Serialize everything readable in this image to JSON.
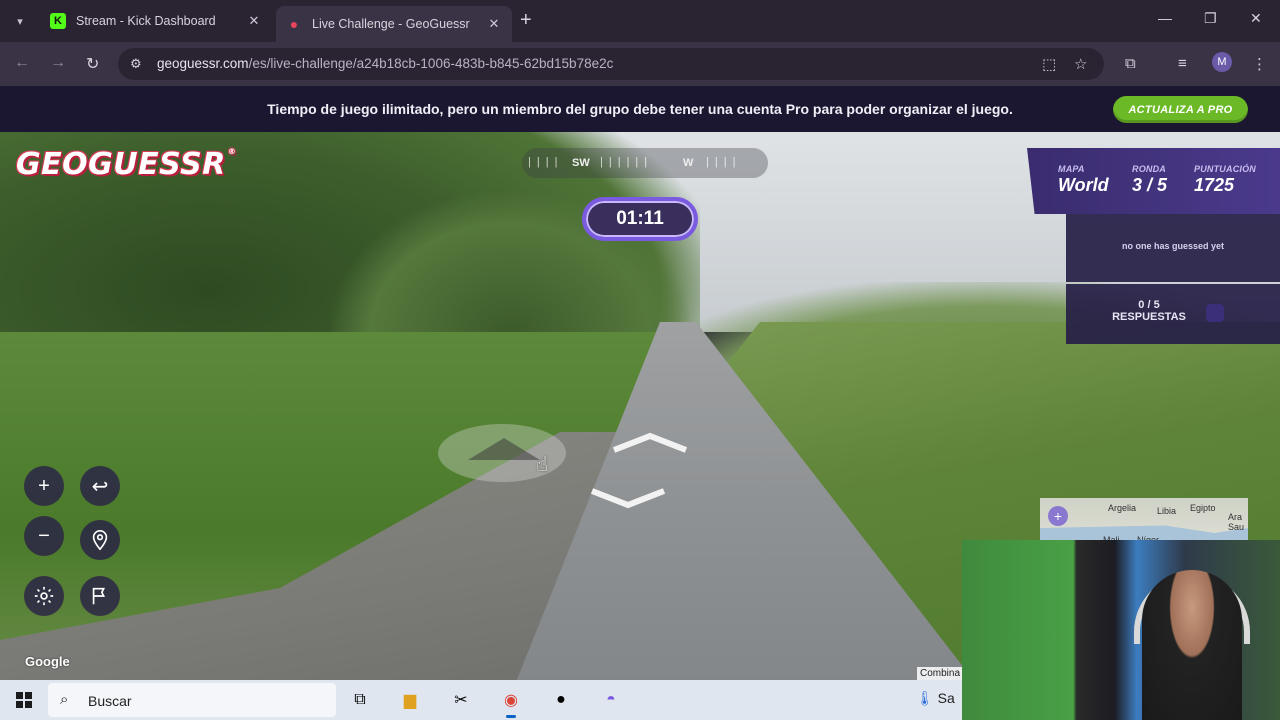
{
  "browser": {
    "tabs": [
      {
        "label": "Stream - Kick Dashboard",
        "favicon": "kick-icon"
      },
      {
        "label": "Live Challenge - GeoGuessr",
        "favicon": "geoguessr-pin-icon",
        "active": true
      }
    ],
    "url_host": "geoguessr.com",
    "url_path": "/es/live-challenge/a24b18cb-1006-483b-b845-62bd15b78e2c",
    "profile_initial": "M"
  },
  "banner": {
    "text": "Tiempo de juego ilimitado, pero un miembro del grupo debe tener una cuenta Pro para poder organizar el juego.",
    "cta_label": "ACTUALIZA A PRO",
    "cta_color": "#6cb928"
  },
  "game": {
    "logo": "GEOGUESSR",
    "compass": {
      "left": "SW",
      "right": "W"
    },
    "timer": "01:11",
    "hud": {
      "map_label": "MAPA",
      "map_value": "World",
      "round_label": "RONDA",
      "round_value": "3 / 5",
      "score_label": "PUNTUACIÓN",
      "score_value": "1725"
    },
    "guess_status": "no one has guessed yet",
    "answers_count": "0 / 5",
    "answers_label": "RESPUESTAS",
    "minimap_labels": {
      "l1": "Argelia",
      "l2": "Libia",
      "l3": "Egipto",
      "l4": "Mali",
      "l5": "Níger",
      "l6": "Ara Sau"
    },
    "google_mark": "Google",
    "combina_text": "Combina"
  },
  "taskbar": {
    "search_placeholder": "Buscar",
    "weather_text": "Sa"
  },
  "colors": {
    "accent": "#7a5ae0",
    "hud_bg": "#3a2c6e"
  }
}
